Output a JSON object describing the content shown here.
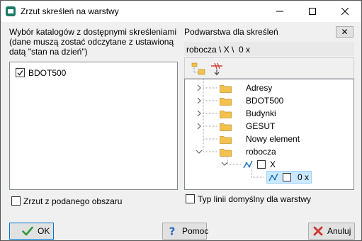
{
  "window": {
    "title": "Zrzut skreśleń na warstwy"
  },
  "left": {
    "heading_line1": "Wybór katalogów z dostępnymi skreśleniami",
    "heading_line2": "(dane muszą zostać odczytane z ustawioną",
    "heading_line3": "datą \"stan na dzień\")",
    "catalogs": [
      {
        "label": "BDOT500",
        "checked": true
      }
    ],
    "area_checkbox": {
      "label": "Zrzut z podanego obszaru",
      "checked": false
    }
  },
  "right": {
    "heading": "Podwarstwa dla skreśleń",
    "path": "robocza \\ X \\  0 x",
    "close_label": "✕",
    "tree": [
      {
        "label": "Adresy"
      },
      {
        "label": "BDOT500"
      },
      {
        "label": "Budynki"
      },
      {
        "label": "GESUT"
      },
      {
        "label": "Nowy element"
      },
      {
        "label": "robocza"
      },
      {
        "label": "X"
      },
      {
        "label": "0 x"
      }
    ],
    "default_line_checkbox": {
      "label": "Typ linii domyślny dla warstwy",
      "checked": false
    }
  },
  "buttons": {
    "ok": "OK",
    "help": "Pomoc",
    "cancel": "Anuluj"
  },
  "colors": {
    "folder": "#f2c14e",
    "selection": "#cce8ff",
    "ok_check": "#2e9a3e",
    "cancel_x": "#d0342c",
    "help": "#1e6fc0"
  }
}
